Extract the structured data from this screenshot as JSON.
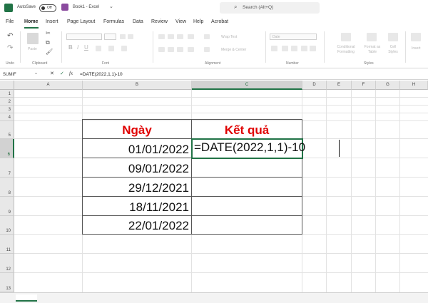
{
  "titlebar": {
    "autosave_label": "AutoSave",
    "autosave_state": "Off",
    "workbook_title": "Book1 - Excel",
    "search_placeholder": "Search (Alt+Q)"
  },
  "ribbon": {
    "tabs": [
      "File",
      "Home",
      "Insert",
      "Page Layout",
      "Formulas",
      "Data",
      "Review",
      "View",
      "Help",
      "Acrobat"
    ],
    "active_tab": "Home",
    "groups": {
      "undo": "Undo",
      "clipboard": "Clipboard",
      "paste": "Paste",
      "font": "Font",
      "alignment": "Alignment",
      "number": "Number",
      "styles": "Styles",
      "insert": "Insert"
    },
    "controls": {
      "wrap_text": "Wrap Text",
      "merge_center": "Merge & Center",
      "number_format": "Date",
      "conditional_formatting": "Conditional Formatting",
      "format_as_table": "Format as Table",
      "cell_styles": "Cell Styles"
    },
    "accent_color": "#217346"
  },
  "formula_bar": {
    "name_box": "SUMIF",
    "cancel_icon": "✕",
    "enter_icon": "✓",
    "fx_label": "fx",
    "formula": "=DATE(2022,1,1)-10"
  },
  "grid": {
    "columns": [
      "A",
      "B",
      "C",
      "D",
      "E",
      "F",
      "G",
      "H"
    ],
    "active_column": "C",
    "rows": [
      "1",
      "2",
      "3",
      "4",
      "5",
      "6",
      "7",
      "8",
      "9",
      "10",
      "11",
      "12",
      "13"
    ],
    "active_row": "6",
    "table": {
      "header_date": "Ngày",
      "header_result": "Kết quả",
      "header_color": "#e00000",
      "dates": [
        "01/01/2022",
        "09/01/2022",
        "29/12/2021",
        "18/11/2021",
        "22/01/2022"
      ],
      "editing_formula": "=DATE(2022,1,1)-10"
    }
  }
}
